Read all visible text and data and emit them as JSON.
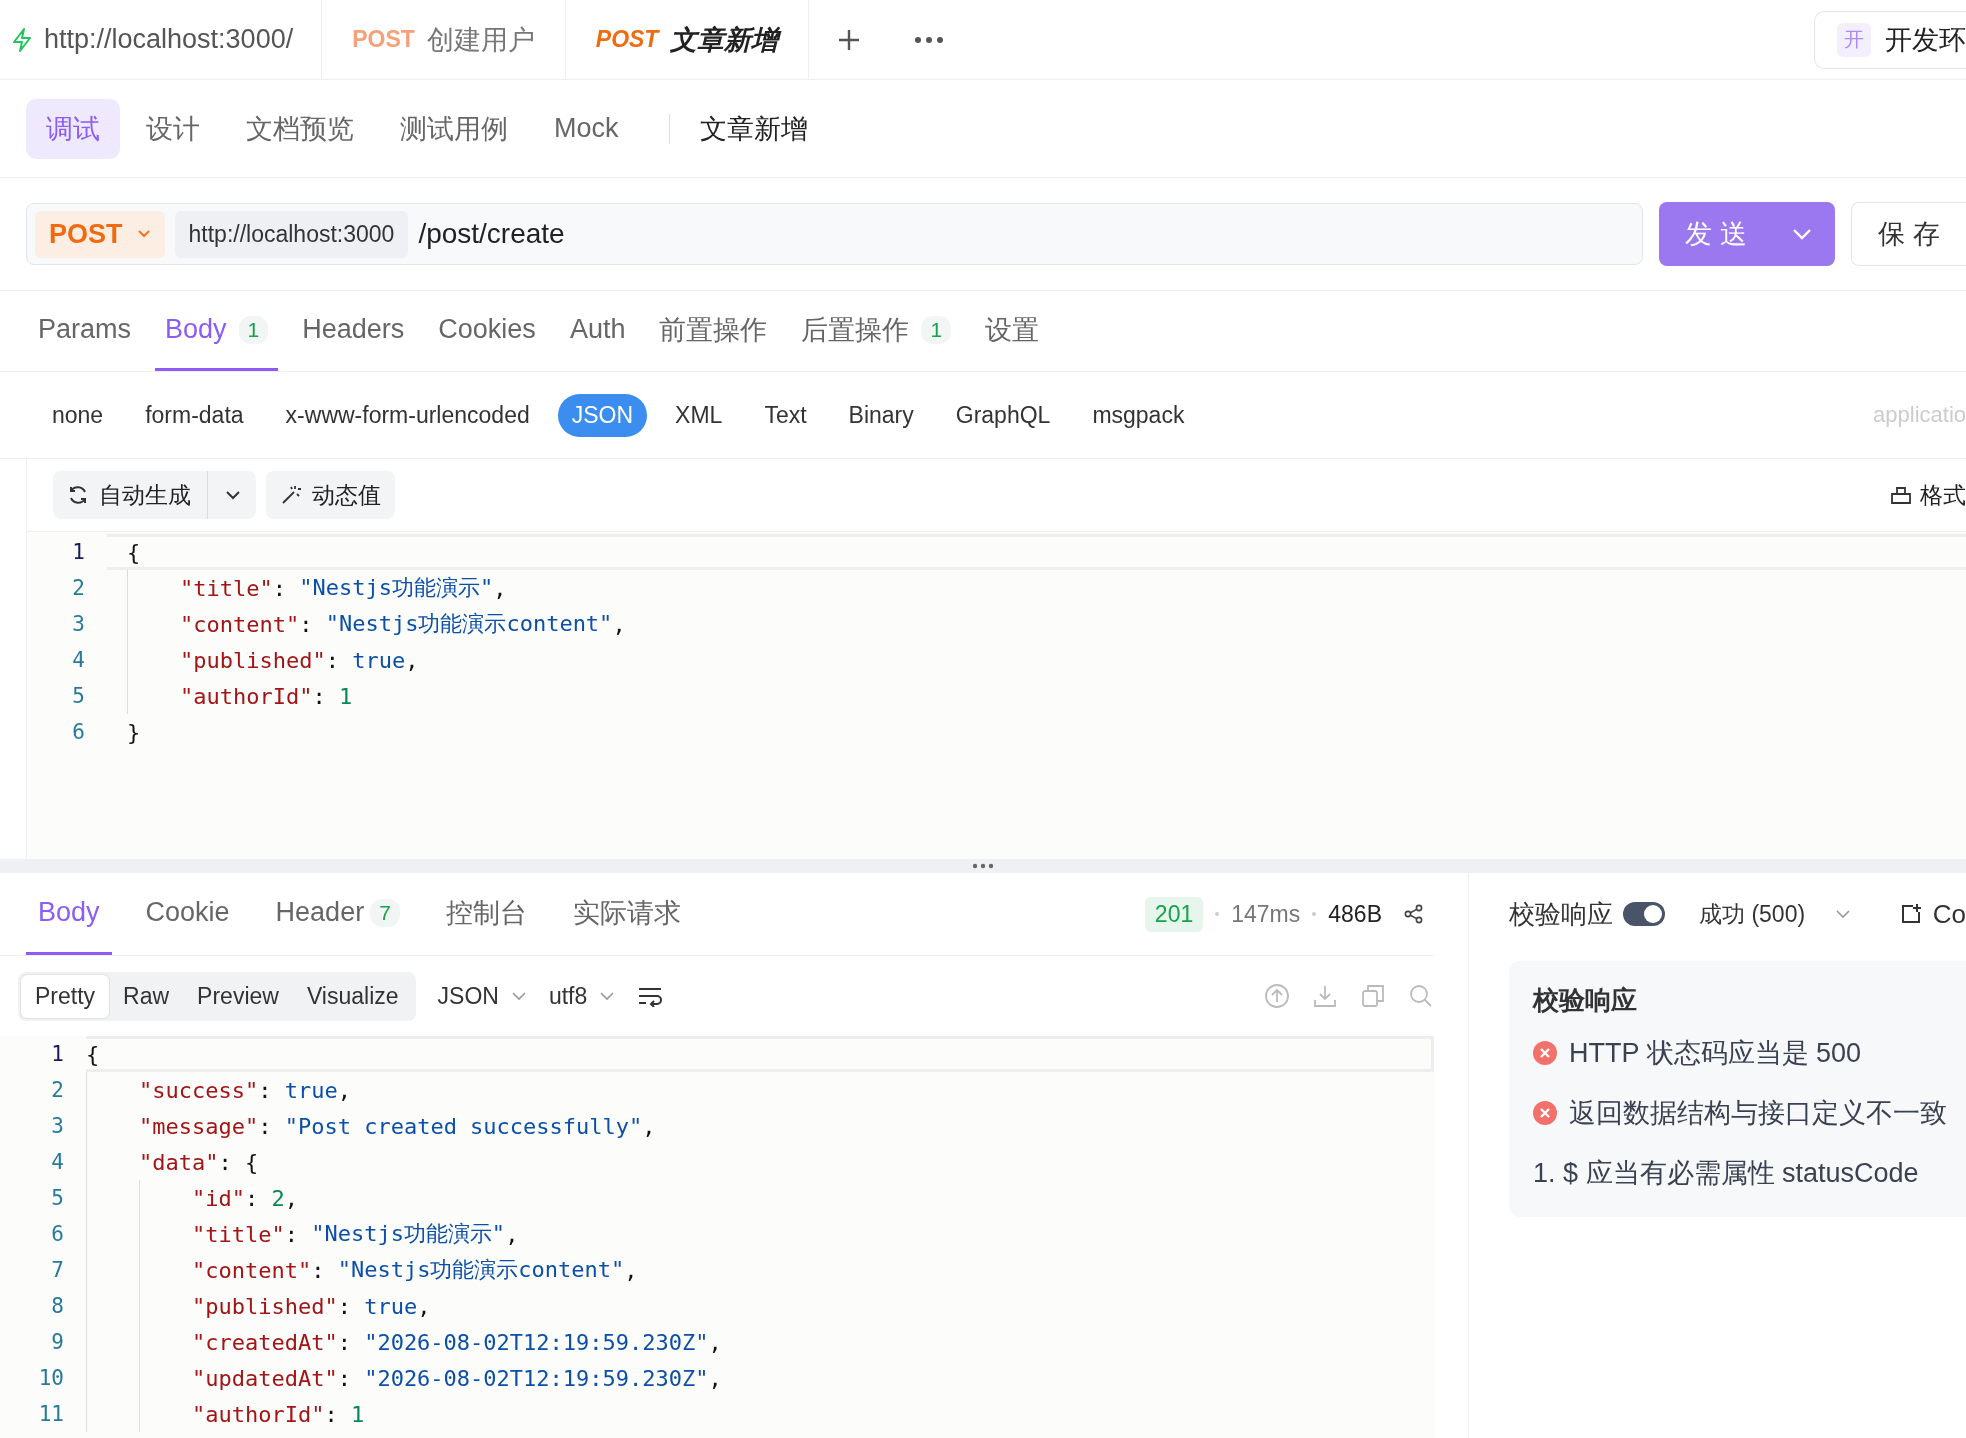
{
  "top_tabs": [
    {
      "kind": "env",
      "label": "http://localhost:3000/",
      "selected": false
    },
    {
      "kind": "request",
      "method": "POST",
      "label": "创建用户",
      "selected": false
    },
    {
      "kind": "request",
      "method": "POST",
      "label": "文章新增",
      "selected": true
    }
  ],
  "environment": {
    "badge": "开",
    "label": "开发环"
  },
  "sub_tabs": [
    {
      "label": "调试",
      "selected": true
    },
    {
      "label": "设计",
      "selected": false
    },
    {
      "label": "文档预览",
      "selected": false
    },
    {
      "label": "测试用例",
      "selected": false
    },
    {
      "label": "Mock",
      "selected": false
    }
  ],
  "api_name": "文章新增",
  "request": {
    "method": "POST",
    "base_url": "http://localhost:3000",
    "path": "/post/create",
    "send": "发 送",
    "save": "保 存"
  },
  "param_tabs": [
    {
      "label": "Params",
      "selected": false
    },
    {
      "label": "Body",
      "count": "1",
      "selected": true
    },
    {
      "label": "Headers",
      "selected": false
    },
    {
      "label": "Cookies",
      "selected": false
    },
    {
      "label": "Auth",
      "selected": false
    },
    {
      "label": "前置操作",
      "selected": false
    },
    {
      "label": "后置操作",
      "count": "1",
      "selected": false
    },
    {
      "label": "设置",
      "selected": false
    }
  ],
  "body_types": [
    {
      "label": "none",
      "selected": false
    },
    {
      "label": "form-data",
      "selected": false
    },
    {
      "label": "x-www-form-urlencoded",
      "selected": false
    },
    {
      "label": "JSON",
      "selected": true
    },
    {
      "label": "XML",
      "selected": false
    },
    {
      "label": "Text",
      "selected": false
    },
    {
      "label": "Binary",
      "selected": false
    },
    {
      "label": "GraphQL",
      "selected": false
    },
    {
      "label": "msgpack",
      "selected": false
    }
  ],
  "content_type": "applicatio",
  "body_toolbar": {
    "auto_generate": "自动生成",
    "dynamic_value": "动态值",
    "format": "格式"
  },
  "request_body": [
    {
      "no": "1",
      "tokens": [
        {
          "kind": "p",
          "text": "{"
        }
      ],
      "children": [
        {
          "no": "2",
          "tokens": [
            {
              "kind": "k",
              "text": "\"title\""
            },
            {
              "kind": "p",
              "text": ": "
            },
            {
              "kind": "s",
              "text": "\"Nestjs功能演示\""
            },
            {
              "kind": "p",
              "text": ","
            }
          ]
        },
        {
          "no": "3",
          "tokens": [
            {
              "kind": "k",
              "text": "\"content\""
            },
            {
              "kind": "p",
              "text": ": "
            },
            {
              "kind": "s",
              "text": "\"Nestjs功能演示content\""
            },
            {
              "kind": "p",
              "text": ","
            }
          ]
        },
        {
          "no": "4",
          "tokens": [
            {
              "kind": "k",
              "text": "\"published\""
            },
            {
              "kind": "p",
              "text": ": "
            },
            {
              "kind": "b",
              "text": "true"
            },
            {
              "kind": "p",
              "text": ","
            }
          ]
        },
        {
          "no": "5",
          "tokens": [
            {
              "kind": "k",
              "text": "\"authorId\""
            },
            {
              "kind": "p",
              "text": ": "
            },
            {
              "kind": "n",
              "text": "1"
            }
          ]
        }
      ]
    },
    {
      "no": "6",
      "tokens": [
        {
          "kind": "p",
          "text": "}"
        }
      ]
    }
  ],
  "response": {
    "tabs": [
      {
        "label": "Body",
        "selected": true
      },
      {
        "label": "Cookie",
        "selected": false
      },
      {
        "label": "Header",
        "count": "7",
        "selected": false
      },
      {
        "label": "控制台",
        "selected": false
      },
      {
        "label": "实际请求",
        "selected": false
      }
    ],
    "status": "201",
    "time": "147ms",
    "size": "486B",
    "views": [
      {
        "label": "Pretty",
        "selected": true
      },
      {
        "label": "Raw",
        "selected": false
      },
      {
        "label": "Preview",
        "selected": false
      },
      {
        "label": "Visualize",
        "selected": false
      }
    ],
    "format": "JSON",
    "encoding": "utf8",
    "lines": [
      {
        "no": "1",
        "tokens": [
          {
            "kind": "p",
            "text": "{"
          }
        ],
        "children": [
          {
            "no": "2",
            "tokens": [
              {
                "kind": "k",
                "text": "\"success\""
              },
              {
                "kind": "p",
                "text": ": "
              },
              {
                "kind": "b",
                "text": "true"
              },
              {
                "kind": "p",
                "text": ","
              }
            ]
          },
          {
            "no": "3",
            "tokens": [
              {
                "kind": "k",
                "text": "\"message\""
              },
              {
                "kind": "p",
                "text": ": "
              },
              {
                "kind": "s",
                "text": "\"Post created successfully\""
              },
              {
                "kind": "p",
                "text": ","
              }
            ]
          },
          {
            "no": "4",
            "tokens": [
              {
                "kind": "k",
                "text": "\"data\""
              },
              {
                "kind": "p",
                "text": ": {"
              }
            ],
            "children": [
              {
                "no": "5",
                "tokens": [
                  {
                    "kind": "k",
                    "text": "\"id\""
                  },
                  {
                    "kind": "p",
                    "text": ": "
                  },
                  {
                    "kind": "n",
                    "text": "2"
                  },
                  {
                    "kind": "p",
                    "text": ","
                  }
                ]
              },
              {
                "no": "6",
                "tokens": [
                  {
                    "kind": "k",
                    "text": "\"title\""
                  },
                  {
                    "kind": "p",
                    "text": ": "
                  },
                  {
                    "kind": "s",
                    "text": "\"Nestjs功能演示\""
                  },
                  {
                    "kind": "p",
                    "text": ","
                  }
                ]
              },
              {
                "no": "7",
                "tokens": [
                  {
                    "kind": "k",
                    "text": "\"content\""
                  },
                  {
                    "kind": "p",
                    "text": ": "
                  },
                  {
                    "kind": "s",
                    "text": "\"Nestjs功能演示content\""
                  },
                  {
                    "kind": "p",
                    "text": ","
                  }
                ]
              },
              {
                "no": "8",
                "tokens": [
                  {
                    "kind": "k",
                    "text": "\"published\""
                  },
                  {
                    "kind": "p",
                    "text": ": "
                  },
                  {
                    "kind": "b",
                    "text": "true"
                  },
                  {
                    "kind": "p",
                    "text": ","
                  }
                ]
              },
              {
                "no": "9",
                "tokens": [
                  {
                    "kind": "k",
                    "text": "\"createdAt\""
                  },
                  {
                    "kind": "p",
                    "text": ": "
                  },
                  {
                    "kind": "s",
                    "text": "\"2026-08-02T12:19:59.230Z\""
                  },
                  {
                    "kind": "p",
                    "text": ","
                  }
                ]
              },
              {
                "no": "10",
                "tokens": [
                  {
                    "kind": "k",
                    "text": "\"updatedAt\""
                  },
                  {
                    "kind": "p",
                    "text": ": "
                  },
                  {
                    "kind": "s",
                    "text": "\"2026-08-02T12:19:59.230Z\""
                  },
                  {
                    "kind": "p",
                    "text": ","
                  }
                ]
              },
              {
                "no": "11",
                "tokens": [
                  {
                    "kind": "k",
                    "text": "\"authorId\""
                  },
                  {
                    "kind": "p",
                    "text": ": "
                  },
                  {
                    "kind": "n",
                    "text": "1"
                  }
                ]
              }
            ]
          }
        ]
      }
    ]
  },
  "validation": {
    "label": "校验响应",
    "on": true,
    "result": "成功 (500)",
    "extra": "Co",
    "title": "校验响应",
    "items": [
      {
        "kind": "error",
        "text": "HTTP 状态码应当是 500"
      },
      {
        "kind": "error",
        "text": "返回数据结构与接口定义不一致"
      },
      {
        "kind": "plain",
        "text": "1. $ 应当有必需属性 statusCode"
      }
    ]
  }
}
